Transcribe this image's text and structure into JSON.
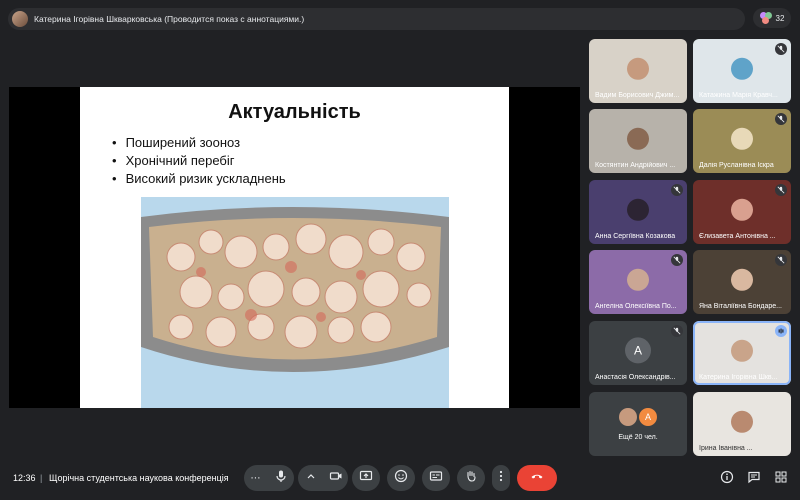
{
  "header": {
    "presenter_text": "Катерина Ігорівна Шкварковська (Проводится показ с аннотациями.)",
    "participant_count": "32"
  },
  "slide": {
    "title": "Актуальність",
    "bullets": [
      "Поширений зооноз",
      "Хронічний перебіг",
      "Високий ризик ускладнень"
    ]
  },
  "tiles": [
    {
      "name": "Вадим Борисович Джим...",
      "muted": false
    },
    {
      "name": "Катажина Марія Кравч...",
      "muted": true
    },
    {
      "name": "Костянтин Андрійович ...",
      "muted": false
    },
    {
      "name": "Далія Русланівна Іскра",
      "muted": true
    },
    {
      "name": "Анна Сергіївна Козакова",
      "muted": true
    },
    {
      "name": "Єлизавета Антонівна ...",
      "muted": true
    },
    {
      "name": "Ангеліна Олексіївна По...",
      "muted": true
    },
    {
      "name": "Яна Віталіївна Бондаре...",
      "muted": true
    },
    {
      "name": "Анастасія Олександрів...",
      "muted": true,
      "initial": "A"
    },
    {
      "name": "Катерина Ігорівна Шкв...",
      "muted": false
    },
    {
      "name": "Ірина Іванівна ...",
      "muted": false
    }
  ],
  "more_tile": {
    "initial": "A",
    "label": "Ещё 20 чел."
  },
  "footer": {
    "time": "12:36",
    "separator": "|",
    "meeting_title": "Щорічна студентська наукова конференція"
  },
  "colors": {
    "end_call": "#ea4335",
    "accent": "#8ab4f8",
    "bg": "#202124"
  }
}
